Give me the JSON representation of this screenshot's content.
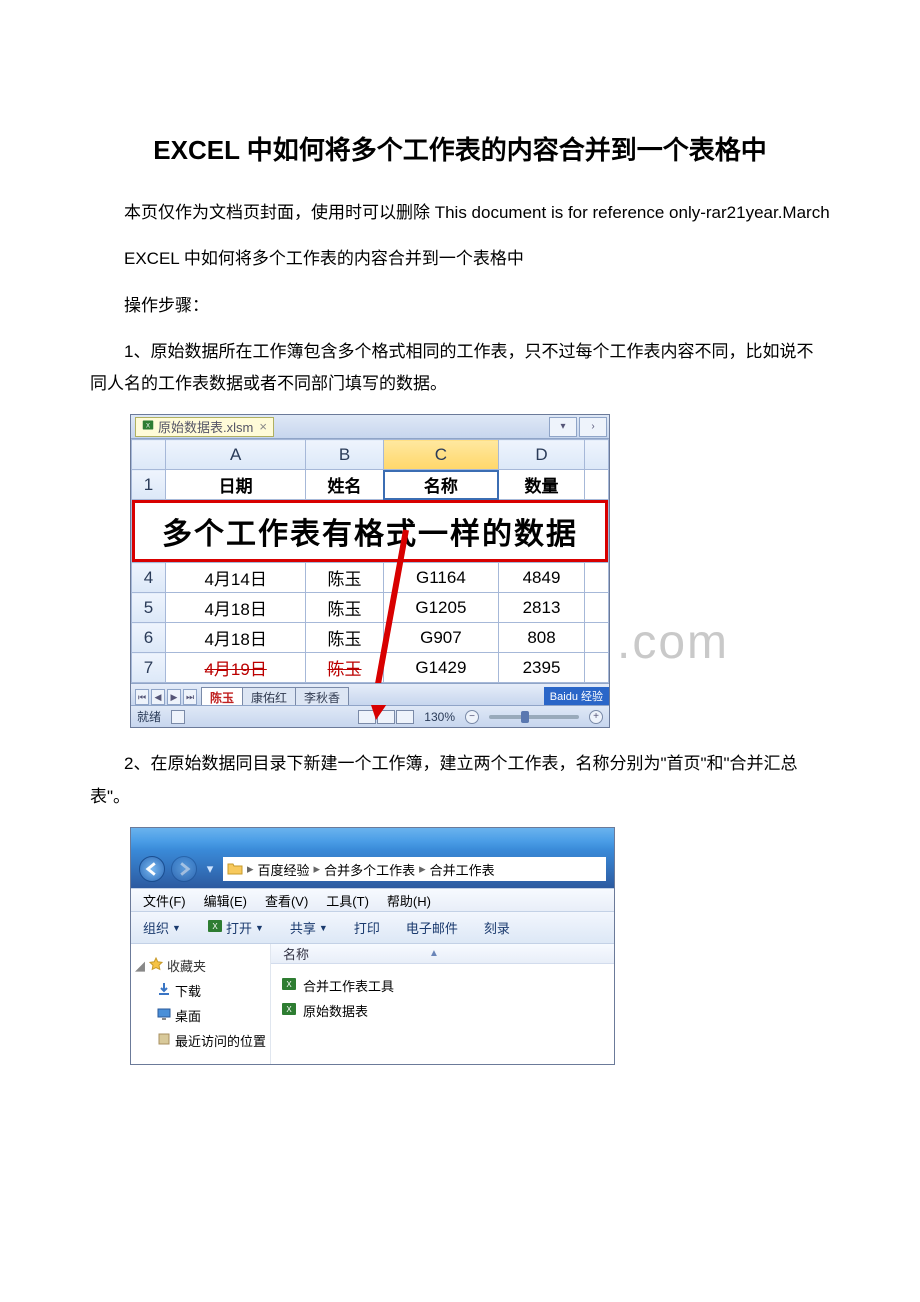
{
  "title": "EXCEL 中如何将多个工作表的内容合并到一个表格中",
  "cover_note": "本页仅作为文档页封面，使用时可以删除 This document is for reference only-rar21year.March",
  "heading2": "EXCEL 中如何将多个工作表的内容合并到一个表格中",
  "steps_label": "操作步骤：",
  "step1": "1、原始数据所在工作簿包含多个格式相同的工作表，只不过每个工作表内容不同，比如说不同人名的工作表数据或者不同部门填写的数据。",
  "step2": "2、在原始数据同目录下新建一个工作簿，建立两个工作表，名称分别为\"首页\"和\"合并汇总表\"。",
  "excel": {
    "workbook_tab": "原始数据表.xlsm",
    "close_x": "×",
    "columns": [
      "A",
      "B",
      "C",
      "D"
    ],
    "header_row": [
      "日期",
      "姓名",
      "名称",
      "数量"
    ],
    "banner": "多个工作表有格式一样的数据",
    "rows": [
      {
        "n": "4",
        "cells": [
          "4月14日",
          "陈玉",
          "G1164",
          "4849"
        ]
      },
      {
        "n": "5",
        "cells": [
          "4月18日",
          "陈玉",
          "G1205",
          "2813"
        ]
      },
      {
        "n": "6",
        "cells": [
          "4月18日",
          "陈玉",
          "G907",
          "808"
        ]
      },
      {
        "n": "7",
        "cells": [
          "4月19日",
          "陈玉",
          "G1429",
          "2395"
        ]
      }
    ],
    "sheet_tabs": [
      "陈玉",
      "康佑红",
      "李秋香"
    ],
    "logo": "Baidu 经验",
    "status_ready": "就绪",
    "zoom": "130%",
    "watermark": ".com"
  },
  "explorer": {
    "breadcrumb": [
      "百度经验",
      "合并多个工作表",
      "合并工作表"
    ],
    "menu": [
      "文件(F)",
      "编辑(E)",
      "查看(V)",
      "工具(T)",
      "帮助(H)"
    ],
    "toolbar": {
      "org": "组织",
      "open": "打开",
      "share": "共享",
      "print": "打印",
      "email": "电子邮件",
      "burn": "刻录"
    },
    "col_name": "名称",
    "side": {
      "fav": "收藏夹",
      "download": "下载",
      "desktop": "桌面",
      "recent": "最近访问的位置"
    },
    "files": [
      "合并工作表工具",
      "原始数据表"
    ]
  }
}
